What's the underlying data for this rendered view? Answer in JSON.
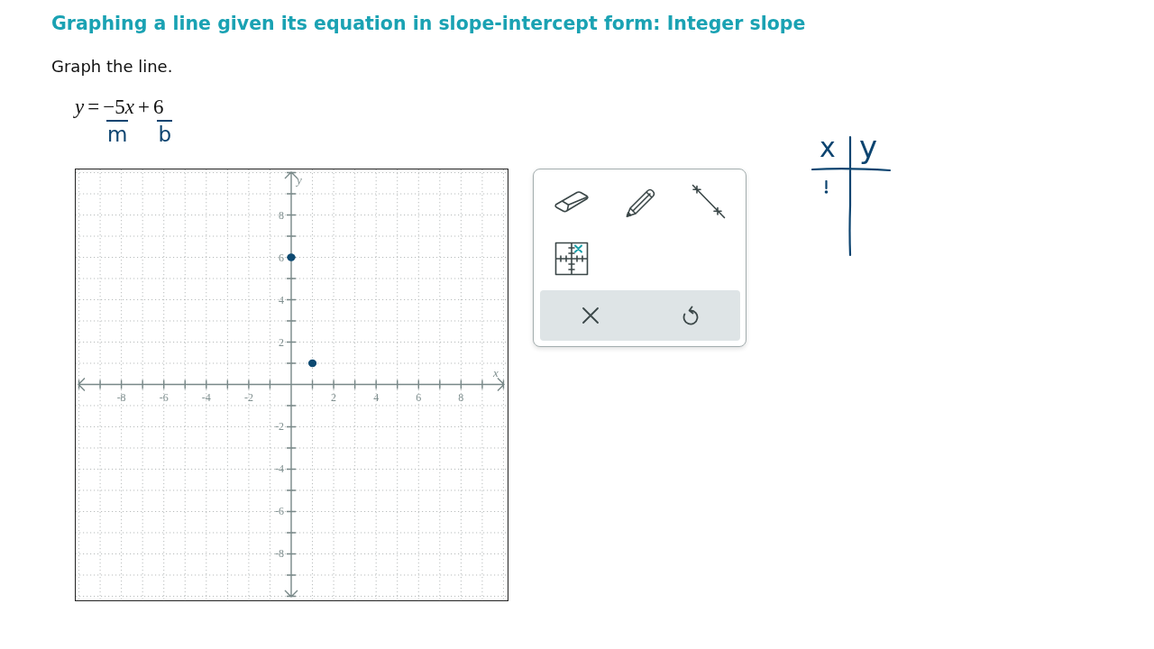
{
  "title": "Graphing a line given its equation in slope-intercept form: Integer slope",
  "prompt": "Graph the line.",
  "equation": {
    "parts": [
      {
        "text": "y",
        "kind": "variable"
      },
      {
        "text": "=",
        "kind": "operator"
      },
      {
        "text": "−5",
        "kind": "number"
      },
      {
        "text": "x",
        "kind": "variable"
      },
      {
        "text": "+",
        "kind": "operator"
      },
      {
        "text": "6",
        "kind": "number"
      }
    ],
    "handwritten_marks": [
      "m",
      "b"
    ]
  },
  "graph": {
    "chart_data": [
      {
        "type": "scatter",
        "xlabel": "x",
        "ylabel": "y",
        "x": [
          0,
          1
        ],
        "values": [
          6,
          1
        ],
        "color": "#0d4a72",
        "xlim": [
          -10.15,
          10.15
        ],
        "ylim": [
          -10.15,
          10.15
        ],
        "xticks": [
          -8,
          -6,
          -4,
          -2,
          2,
          4,
          6,
          8
        ],
        "yticks": [
          -8,
          -6,
          -4,
          -2,
          2,
          4,
          6,
          8
        ],
        "grid": true
      }
    ]
  },
  "t_chart": {
    "headers": [
      "x",
      "y"
    ]
  }
}
